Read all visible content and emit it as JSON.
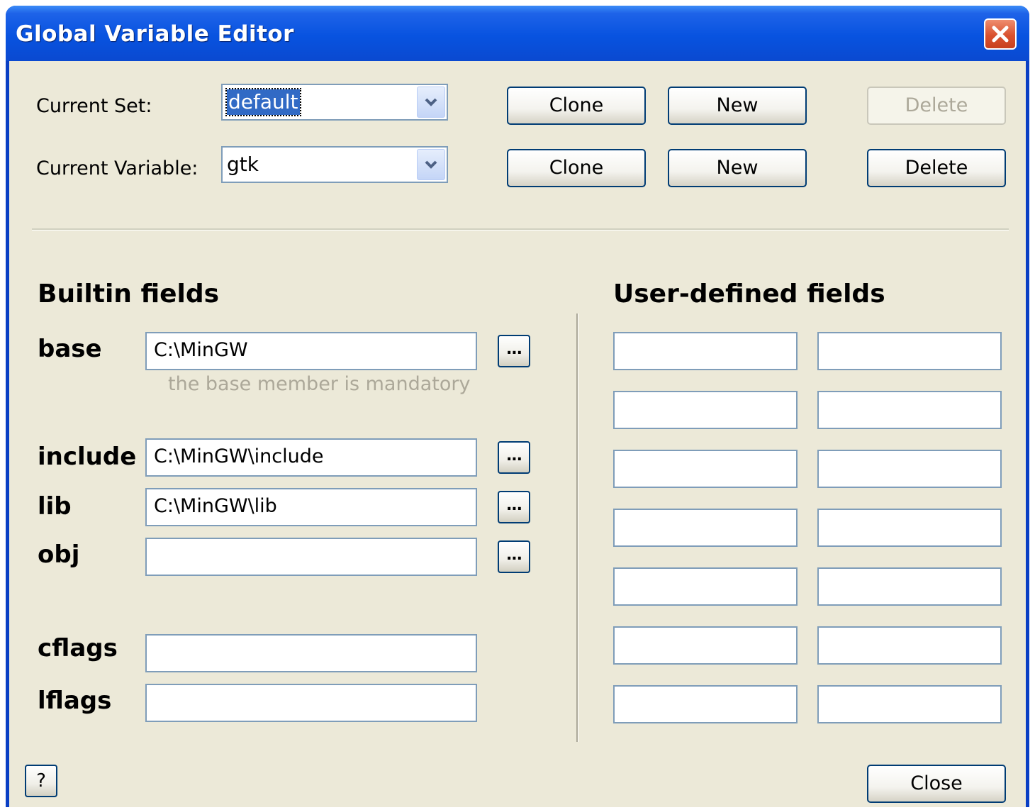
{
  "window": {
    "title": "Global Variable Editor"
  },
  "top": {
    "current_set_label": "Current Set:",
    "current_set_value": "default",
    "current_variable_label": "Current Variable:",
    "current_variable_value": "gtk",
    "set_clone": "Clone",
    "set_new": "New",
    "set_delete": "Delete",
    "set_delete_enabled": false,
    "var_clone": "Clone",
    "var_new": "New",
    "var_delete": "Delete"
  },
  "builtin": {
    "heading": "Builtin fields",
    "base_label": "base",
    "base_value": "C:\\MinGW",
    "base_hint": "the base member is mandatory",
    "include_label": "include",
    "include_value": "C:\\MinGW\\include",
    "lib_label": "lib",
    "lib_value": "C:\\MinGW\\lib",
    "obj_label": "obj",
    "obj_value": "",
    "cflags_label": "cflags",
    "cflags_value": "",
    "lflags_label": "lflags",
    "lflags_value": "",
    "browse_label": "..."
  },
  "user": {
    "heading": "User-defined fields",
    "rows": [
      [
        "",
        ""
      ],
      [
        "",
        ""
      ],
      [
        "",
        ""
      ],
      [
        "",
        ""
      ],
      [
        "",
        ""
      ],
      [
        "",
        ""
      ],
      [
        "",
        ""
      ]
    ]
  },
  "bottom": {
    "help_label": "?",
    "close_label": "Close"
  }
}
